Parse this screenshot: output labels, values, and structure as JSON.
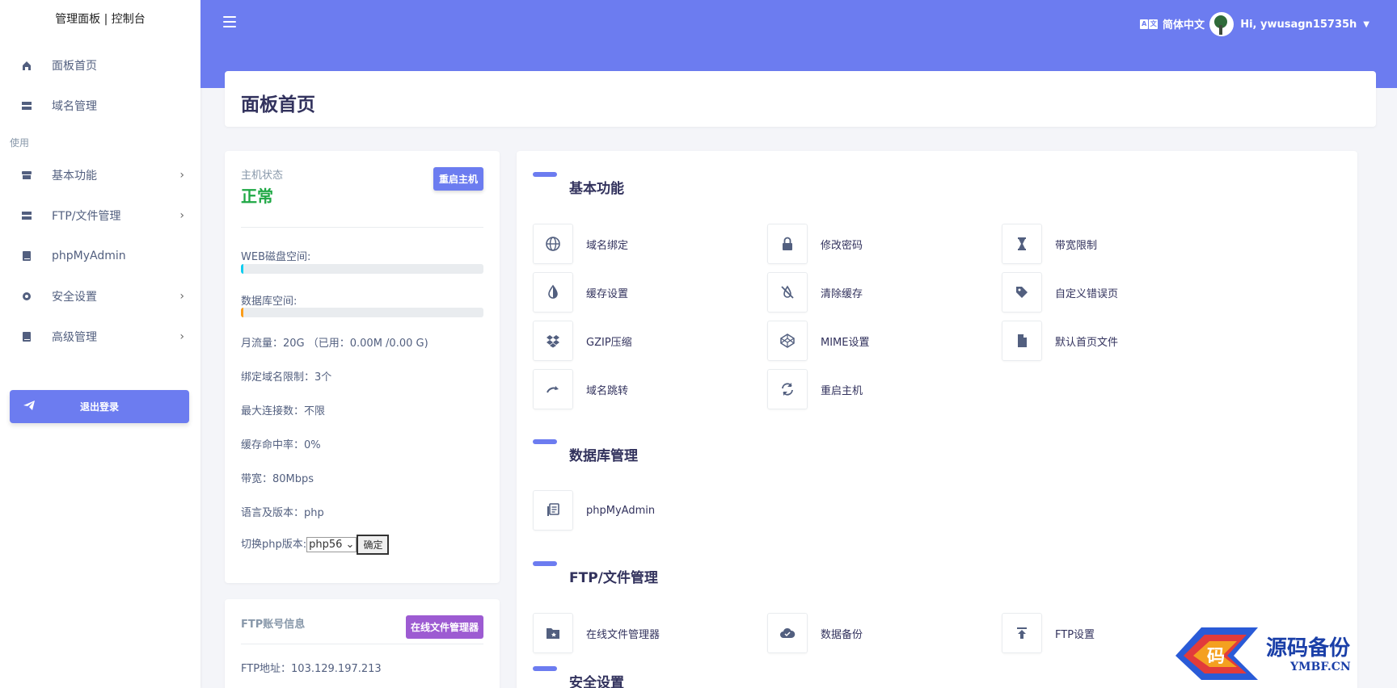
{
  "sidebar": {
    "brand": "管理面板 | 控制台",
    "top_items": [
      {
        "label": "面板首页",
        "icon": "home-icon"
      },
      {
        "label": "域名管理",
        "icon": "server-icon"
      }
    ],
    "heading": "使用",
    "items": [
      {
        "label": "基本功能",
        "icon": "archive-icon",
        "has_arrow": true
      },
      {
        "label": "FTP/文件管理",
        "icon": "server-icon",
        "has_arrow": true
      },
      {
        "label": "phpMyAdmin",
        "icon": "book-icon",
        "has_arrow": false
      },
      {
        "label": "安全设置",
        "icon": "gear-icon",
        "has_arrow": true
      },
      {
        "label": "高级管理",
        "icon": "book-icon",
        "has_arrow": true
      }
    ],
    "logout_label": "退出登录"
  },
  "header": {
    "language": "简体中文",
    "user_greeting": "Hi, ywusagn15735h"
  },
  "page_title": "面板首页",
  "host": {
    "label": "主机状态",
    "status": "正常",
    "status_color": "#1fa845",
    "restart_label": "重启主机",
    "web_disk_label": "WEB磁盘空间:",
    "web_disk_fraction": 0.01,
    "web_disk_color": "#11cdef",
    "db_label": "数据库空间:",
    "db_fraction": 0.01,
    "db_color": "#fb9d1a",
    "traffic": "月流量：20G （已用：0.00M /0.00 G)",
    "domain_limit": "绑定域名限制：3个",
    "max_conn": "最大连接数：不限",
    "cache_hit": "缓存命中率：0%",
    "bandwidth": "带宽：80Mbps",
    "language_version": "语言及版本：php",
    "switch_php_label": "切换php版本:",
    "php_selected": "php56",
    "confirm_label": "确定"
  },
  "ftp": {
    "label": "FTP账号信息",
    "file_manager_label": "在线文件管理器",
    "address": "FTP地址：103.129.197.213"
  },
  "sections": [
    {
      "title": "基本功能",
      "items": [
        {
          "label": "域名绑定",
          "icon": "globe-icon"
        },
        {
          "label": "修改密码",
          "icon": "lock-icon"
        },
        {
          "label": "带宽限制",
          "icon": "hourglass-icon"
        },
        {
          "label": "缓存设置",
          "icon": "contrast-icon"
        },
        {
          "label": "清除缓存",
          "icon": "tint-slash-icon"
        },
        {
          "label": "自定义错误页",
          "icon": "tags-icon"
        },
        {
          "label": "GZIP压缩",
          "icon": "dropbox-icon"
        },
        {
          "label": "MIME设置",
          "icon": "codepen-icon"
        },
        {
          "label": "默认首页文件",
          "icon": "file-icon"
        },
        {
          "label": "域名跳转",
          "icon": "redo-icon"
        },
        {
          "label": "重启主机",
          "icon": "sync-icon"
        }
      ]
    },
    {
      "title": "数据库管理",
      "items": [
        {
          "label": "phpMyAdmin",
          "icon": "database-book-icon"
        }
      ]
    },
    {
      "title": "FTP/文件管理",
      "items": [
        {
          "label": "在线文件管理器",
          "icon": "folder-star-icon"
        },
        {
          "label": "数据备份",
          "icon": "cloud-icon"
        },
        {
          "label": "FTP设置",
          "icon": "upload-icon"
        }
      ]
    },
    {
      "title": "安全设置",
      "items": []
    }
  ],
  "watermark": {
    "text": "源码备份",
    "sub": "YMBF.CN",
    "logo_char": "码"
  },
  "colors": {
    "primary": "#6c7cf0",
    "purple_button": "#9d5bd2"
  }
}
